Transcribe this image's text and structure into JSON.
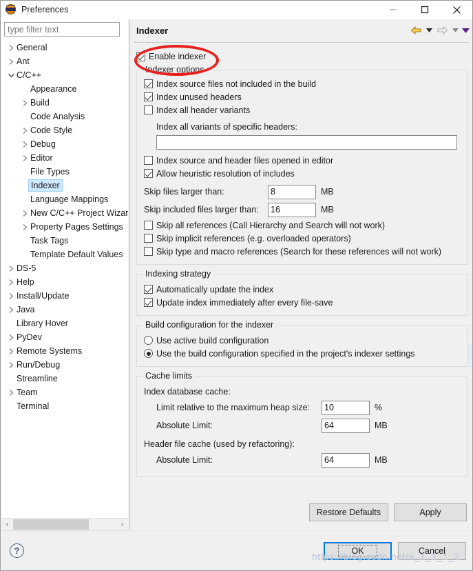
{
  "window": {
    "title": "Preferences",
    "icon": "eclipse-globe-icon",
    "minimize_label": "–",
    "maximize_label": "□",
    "close_label": "✕"
  },
  "sidebar": {
    "filter": {
      "value": "",
      "placeholder": "type filter text"
    },
    "items": [
      {
        "label": "General",
        "indent": 0,
        "twisty": "collapsed",
        "selected": false
      },
      {
        "label": "Ant",
        "indent": 0,
        "twisty": "collapsed",
        "selected": false
      },
      {
        "label": "C/C++",
        "indent": 0,
        "twisty": "expanded",
        "selected": false
      },
      {
        "label": "Appearance",
        "indent": 1,
        "twisty": "none",
        "selected": false
      },
      {
        "label": "Build",
        "indent": 1,
        "twisty": "collapsed",
        "selected": false
      },
      {
        "label": "Code Analysis",
        "indent": 1,
        "twisty": "none",
        "selected": false
      },
      {
        "label": "Code Style",
        "indent": 1,
        "twisty": "collapsed",
        "selected": false
      },
      {
        "label": "Debug",
        "indent": 1,
        "twisty": "collapsed",
        "selected": false
      },
      {
        "label": "Editor",
        "indent": 1,
        "twisty": "collapsed",
        "selected": false
      },
      {
        "label": "File Types",
        "indent": 1,
        "twisty": "none",
        "selected": false
      },
      {
        "label": "Indexer",
        "indent": 1,
        "twisty": "none",
        "selected": true
      },
      {
        "label": "Language Mappings",
        "indent": 1,
        "twisty": "none",
        "selected": false
      },
      {
        "label": "New C/C++ Project Wizard",
        "indent": 1,
        "twisty": "collapsed",
        "selected": false
      },
      {
        "label": "Property Pages Settings",
        "indent": 1,
        "twisty": "collapsed",
        "selected": false
      },
      {
        "label": "Task Tags",
        "indent": 1,
        "twisty": "none",
        "selected": false
      },
      {
        "label": "Template Default Values",
        "indent": 1,
        "twisty": "none",
        "selected": false
      },
      {
        "label": "DS-5",
        "indent": 0,
        "twisty": "collapsed",
        "selected": false
      },
      {
        "label": "Help",
        "indent": 0,
        "twisty": "collapsed",
        "selected": false
      },
      {
        "label": "Install/Update",
        "indent": 0,
        "twisty": "collapsed",
        "selected": false
      },
      {
        "label": "Java",
        "indent": 0,
        "twisty": "collapsed",
        "selected": false
      },
      {
        "label": "Library Hover",
        "indent": 0,
        "twisty": "none",
        "selected": false
      },
      {
        "label": "PyDev",
        "indent": 0,
        "twisty": "collapsed",
        "selected": false
      },
      {
        "label": "Remote Systems",
        "indent": 0,
        "twisty": "collapsed",
        "selected": false
      },
      {
        "label": "Run/Debug",
        "indent": 0,
        "twisty": "collapsed",
        "selected": false
      },
      {
        "label": "Streamline",
        "indent": 0,
        "twisty": "none",
        "selected": false
      },
      {
        "label": "Team",
        "indent": 0,
        "twisty": "collapsed",
        "selected": false
      },
      {
        "label": "Terminal",
        "indent": 0,
        "twisty": "none",
        "selected": false
      }
    ],
    "scroll_left_label": "‹",
    "scroll_right_label": "›"
  },
  "page": {
    "title": "Indexer",
    "nav": {
      "back_icon": "back-arrow-icon",
      "back_menu_icon": "chevron-down-icon",
      "forward_icon": "forward-arrow-icon",
      "forward_menu_icon": "chevron-down-icon",
      "view_menu_icon": "view-menu-icon"
    },
    "enable_indexer": {
      "label": "Enable indexer",
      "checked": true
    },
    "indexer_options": {
      "title": "Indexer options",
      "checks": [
        {
          "label": "Index source files not included in the build",
          "checked": true
        },
        {
          "label": "Index unused headers",
          "checked": true
        },
        {
          "label": "Index all header variants",
          "checked": false
        }
      ],
      "variants_label": "Index all variants of specific headers:",
      "variants_value": "",
      "checks2": [
        {
          "label": "Index source and header files opened in editor",
          "checked": false
        },
        {
          "label": "Allow heuristic resolution of includes",
          "checked": true
        }
      ],
      "skip_files_label": "Skip files larger than:",
      "skip_files_value": "8",
      "skip_files_unit": "MB",
      "skip_included_label": "Skip included files larger than:",
      "skip_included_value": "16",
      "skip_included_unit": "MB",
      "checks3": [
        {
          "label": "Skip all references (Call Hierarchy and Search will not work)",
          "checked": false
        },
        {
          "label": "Skip implicit references (e.g. overloaded operators)",
          "checked": false
        },
        {
          "label": "Skip type and macro references (Search for these references will not work)",
          "checked": false
        }
      ]
    },
    "indexing_strategy": {
      "title": "Indexing strategy",
      "checks": [
        {
          "label": "Automatically update the index",
          "checked": true
        },
        {
          "label": "Update index immediately after every file-save",
          "checked": true
        }
      ]
    },
    "build_config": {
      "title": "Build configuration for the indexer",
      "radios": [
        {
          "label": "Use active build configuration",
          "checked": false
        },
        {
          "label": "Use the build configuration specified in the project's indexer settings",
          "checked": true
        }
      ]
    },
    "cache_limits": {
      "title": "Cache limits",
      "db_cache_label": "Index database cache:",
      "heap_limit_label": "Limit relative to the maximum heap size:",
      "heap_limit_value": "10",
      "heap_limit_unit": "%",
      "db_abs_label": "Absolute Limit:",
      "db_abs_value": "64",
      "db_abs_unit": "MB",
      "header_cache_label": "Header file cache (used by refactoring):",
      "header_abs_label": "Absolute Limit:",
      "header_abs_value": "64",
      "header_abs_unit": "MB"
    },
    "restore_defaults_label": "Restore Defaults",
    "apply_label": "Apply"
  },
  "footer": {
    "help_label": "?",
    "ok_label": "OK",
    "cancel_label": "Cancel"
  },
  "annotation": {
    "oval_color": "#e8201e",
    "target": "Enable indexer"
  },
  "watermark": {
    "text": "https://blog.csdn.net/a_1_1_1_2"
  }
}
